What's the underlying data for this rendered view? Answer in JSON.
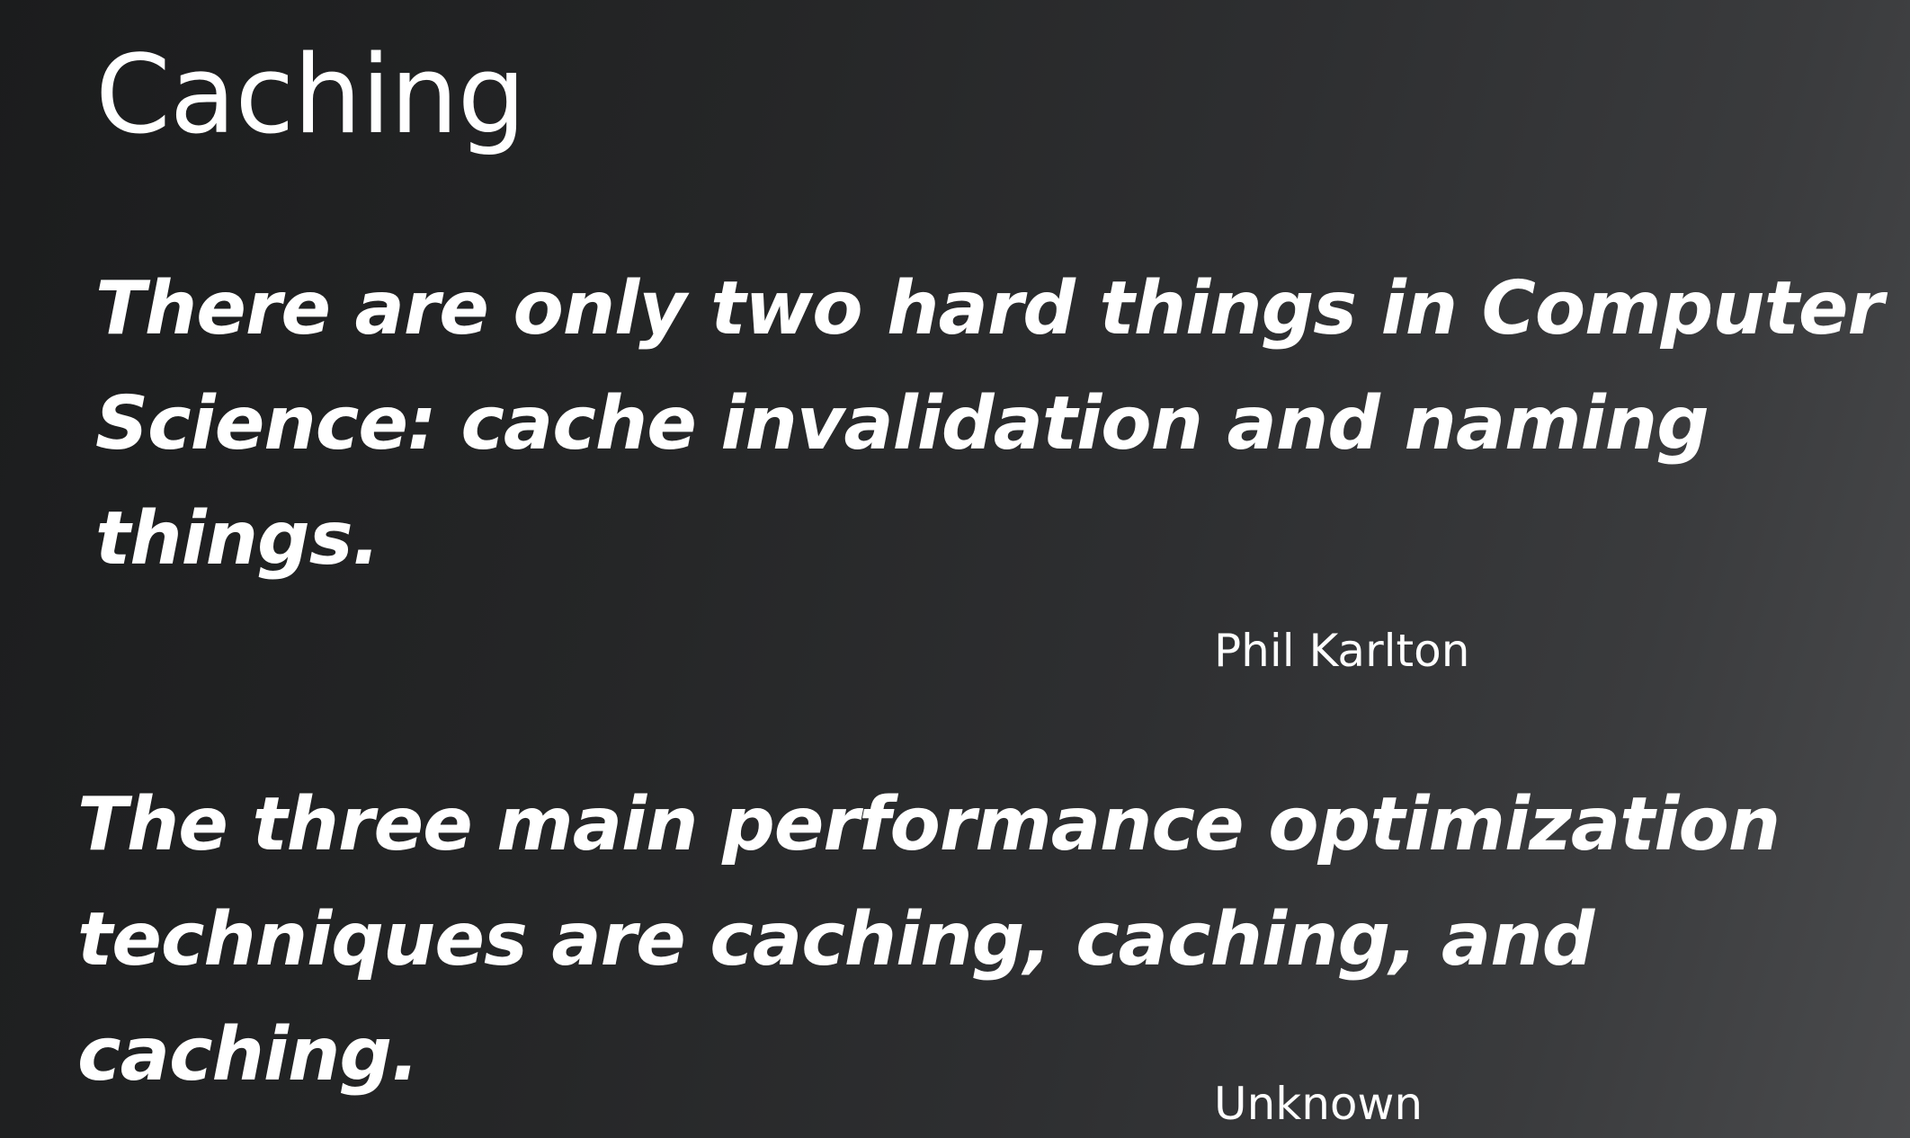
{
  "slide": {
    "title": "Caching",
    "quotes": [
      {
        "lines": [
          "There are only two hard things in Computer",
          "Science: cache invalidation and naming",
          "things."
        ],
        "author": "Phil Karlton"
      },
      {
        "lines": [
          "The three main performance optimization",
          "techniques are caching, caching, and",
          "caching."
        ],
        "author": "Unknown"
      }
    ]
  }
}
